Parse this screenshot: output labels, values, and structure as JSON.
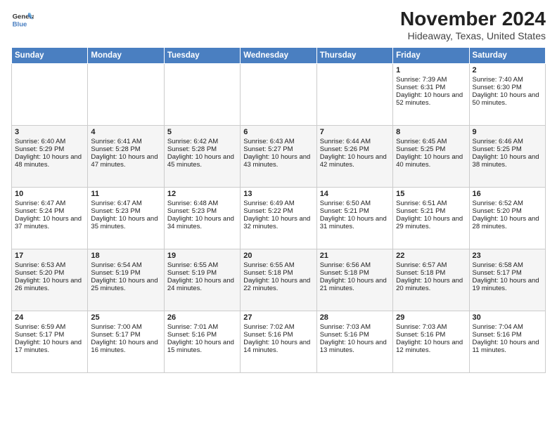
{
  "header": {
    "logo_line1": "General",
    "logo_line2": "Blue",
    "title": "November 2024",
    "subtitle": "Hideaway, Texas, United States"
  },
  "days_of_week": [
    "Sunday",
    "Monday",
    "Tuesday",
    "Wednesday",
    "Thursday",
    "Friday",
    "Saturday"
  ],
  "weeks": [
    [
      {
        "day": "",
        "info": ""
      },
      {
        "day": "",
        "info": ""
      },
      {
        "day": "",
        "info": ""
      },
      {
        "day": "",
        "info": ""
      },
      {
        "day": "",
        "info": ""
      },
      {
        "day": "1",
        "info": "Sunrise: 7:39 AM\nSunset: 6:31 PM\nDaylight: 10 hours and 52 minutes."
      },
      {
        "day": "2",
        "info": "Sunrise: 7:40 AM\nSunset: 6:30 PM\nDaylight: 10 hours and 50 minutes."
      }
    ],
    [
      {
        "day": "3",
        "info": "Sunrise: 6:40 AM\nSunset: 5:29 PM\nDaylight: 10 hours and 48 minutes."
      },
      {
        "day": "4",
        "info": "Sunrise: 6:41 AM\nSunset: 5:28 PM\nDaylight: 10 hours and 47 minutes."
      },
      {
        "day": "5",
        "info": "Sunrise: 6:42 AM\nSunset: 5:28 PM\nDaylight: 10 hours and 45 minutes."
      },
      {
        "day": "6",
        "info": "Sunrise: 6:43 AM\nSunset: 5:27 PM\nDaylight: 10 hours and 43 minutes."
      },
      {
        "day": "7",
        "info": "Sunrise: 6:44 AM\nSunset: 5:26 PM\nDaylight: 10 hours and 42 minutes."
      },
      {
        "day": "8",
        "info": "Sunrise: 6:45 AM\nSunset: 5:25 PM\nDaylight: 10 hours and 40 minutes."
      },
      {
        "day": "9",
        "info": "Sunrise: 6:46 AM\nSunset: 5:25 PM\nDaylight: 10 hours and 38 minutes."
      }
    ],
    [
      {
        "day": "10",
        "info": "Sunrise: 6:47 AM\nSunset: 5:24 PM\nDaylight: 10 hours and 37 minutes."
      },
      {
        "day": "11",
        "info": "Sunrise: 6:47 AM\nSunset: 5:23 PM\nDaylight: 10 hours and 35 minutes."
      },
      {
        "day": "12",
        "info": "Sunrise: 6:48 AM\nSunset: 5:23 PM\nDaylight: 10 hours and 34 minutes."
      },
      {
        "day": "13",
        "info": "Sunrise: 6:49 AM\nSunset: 5:22 PM\nDaylight: 10 hours and 32 minutes."
      },
      {
        "day": "14",
        "info": "Sunrise: 6:50 AM\nSunset: 5:21 PM\nDaylight: 10 hours and 31 minutes."
      },
      {
        "day": "15",
        "info": "Sunrise: 6:51 AM\nSunset: 5:21 PM\nDaylight: 10 hours and 29 minutes."
      },
      {
        "day": "16",
        "info": "Sunrise: 6:52 AM\nSunset: 5:20 PM\nDaylight: 10 hours and 28 minutes."
      }
    ],
    [
      {
        "day": "17",
        "info": "Sunrise: 6:53 AM\nSunset: 5:20 PM\nDaylight: 10 hours and 26 minutes."
      },
      {
        "day": "18",
        "info": "Sunrise: 6:54 AM\nSunset: 5:19 PM\nDaylight: 10 hours and 25 minutes."
      },
      {
        "day": "19",
        "info": "Sunrise: 6:55 AM\nSunset: 5:19 PM\nDaylight: 10 hours and 24 minutes."
      },
      {
        "day": "20",
        "info": "Sunrise: 6:55 AM\nSunset: 5:18 PM\nDaylight: 10 hours and 22 minutes."
      },
      {
        "day": "21",
        "info": "Sunrise: 6:56 AM\nSunset: 5:18 PM\nDaylight: 10 hours and 21 minutes."
      },
      {
        "day": "22",
        "info": "Sunrise: 6:57 AM\nSunset: 5:18 PM\nDaylight: 10 hours and 20 minutes."
      },
      {
        "day": "23",
        "info": "Sunrise: 6:58 AM\nSunset: 5:17 PM\nDaylight: 10 hours and 19 minutes."
      }
    ],
    [
      {
        "day": "24",
        "info": "Sunrise: 6:59 AM\nSunset: 5:17 PM\nDaylight: 10 hours and 17 minutes."
      },
      {
        "day": "25",
        "info": "Sunrise: 7:00 AM\nSunset: 5:17 PM\nDaylight: 10 hours and 16 minutes."
      },
      {
        "day": "26",
        "info": "Sunrise: 7:01 AM\nSunset: 5:16 PM\nDaylight: 10 hours and 15 minutes."
      },
      {
        "day": "27",
        "info": "Sunrise: 7:02 AM\nSunset: 5:16 PM\nDaylight: 10 hours and 14 minutes."
      },
      {
        "day": "28",
        "info": "Sunrise: 7:03 AM\nSunset: 5:16 PM\nDaylight: 10 hours and 13 minutes."
      },
      {
        "day": "29",
        "info": "Sunrise: 7:03 AM\nSunset: 5:16 PM\nDaylight: 10 hours and 12 minutes."
      },
      {
        "day": "30",
        "info": "Sunrise: 7:04 AM\nSunset: 5:16 PM\nDaylight: 10 hours and 11 minutes."
      }
    ]
  ]
}
